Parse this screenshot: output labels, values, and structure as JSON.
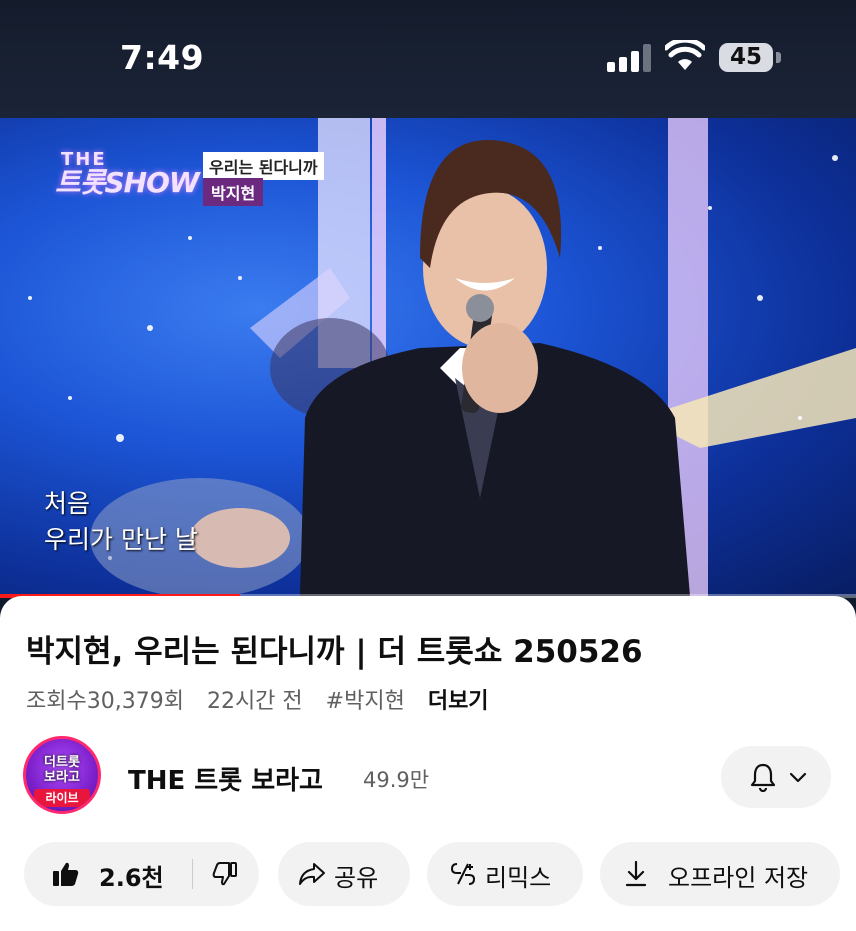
{
  "status_bar": {
    "time": "7:49",
    "battery": "45"
  },
  "video": {
    "show_logo_line1": "THE",
    "show_logo_line2": "트롯SHOW",
    "song_title": "우리는 된다니까",
    "singer": "박지현",
    "caption_line1": "처음",
    "caption_line2": "우리가 만난 날",
    "progress_fraction": 0.28
  },
  "info": {
    "title": "박지현, 우리는 된다니까 | 더 트롯쇼 250526",
    "views": "조회수30,379회",
    "age": "22시간 전",
    "hashtag": "#박지현",
    "more": "더보기"
  },
  "channel": {
    "avatar_line1": "더트롯",
    "avatar_line2": "보라고",
    "avatar_badge": "라이브",
    "name": "THE 트롯 보라고",
    "subscribers": "49.9만"
  },
  "actions": {
    "likes": "2.6천",
    "share": "공유",
    "remix": "리믹스",
    "offline": "오프라인 저장"
  },
  "colors": {
    "accent": "#ff1a1a",
    "chip_bg": "#f2f2f2",
    "meta": "#606060"
  }
}
